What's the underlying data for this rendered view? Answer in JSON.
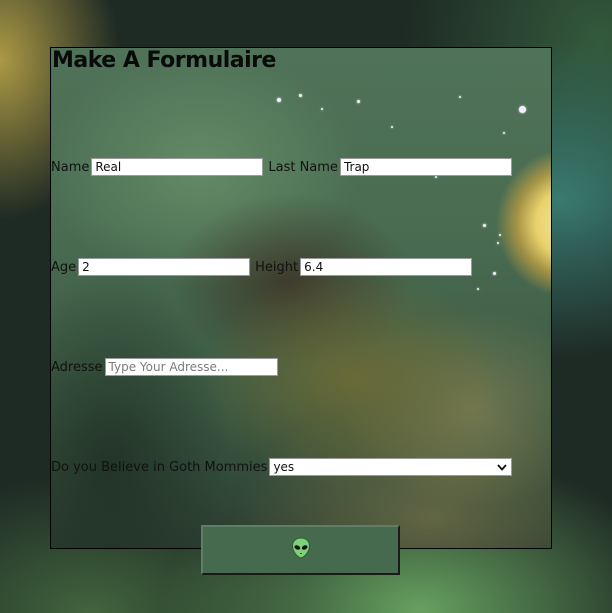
{
  "form": {
    "title": "Make A Formulaire",
    "name_label": "Name",
    "name_value": "Real",
    "last_name_label": "Last Name",
    "last_name_value": "Trap",
    "age_label": "Age",
    "age_value": "2",
    "height_label": "Height",
    "height_value": "6.4",
    "address_label": "Adresse",
    "address_placeholder": "Type Your Adresse...",
    "goth_label": "Do you Believe in Goth Mommies",
    "goth_selected": "yes"
  },
  "submit": {
    "icon": "alien-icon"
  },
  "colors": {
    "button_bg": "#466a4e",
    "alien_green": "#7ed07a"
  }
}
